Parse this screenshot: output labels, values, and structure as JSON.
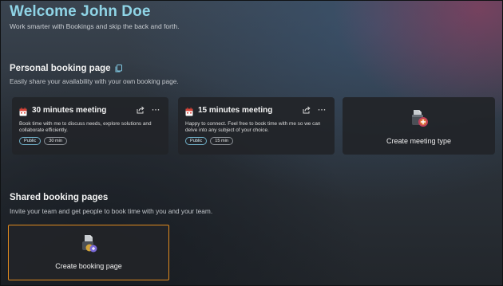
{
  "header": {
    "title": "Welcome John Doe",
    "subtitle": "Work smarter with Bookings and skip the back and forth."
  },
  "personal": {
    "title": "Personal booking page",
    "subtitle": "Easily share your availability with your own booking page.",
    "icon": "copy-link-icon",
    "cards": [
      {
        "title": "30 minutes meeting",
        "description": "Book time with me to discuss needs, explore solutions and collaborate efficiently.",
        "visibility": "Public",
        "duration": "30 min"
      },
      {
        "title": "15 minutes meeting",
        "description": "Happy to connect. Feel free to book time with me so we can delve into any subject of your choice.",
        "visibility": "Public",
        "duration": "15 min"
      }
    ],
    "create_label": "Create meeting type"
  },
  "shared": {
    "title": "Shared booking pages",
    "subtitle": "Invite your team and get people to book time with you and your team.",
    "create_label": "Create booking page"
  },
  "colors": {
    "title": "#8fd4e6",
    "focus_border": "#e08a1e",
    "calendar_red": "#d9473b",
    "badge_public": "#6faec6"
  }
}
